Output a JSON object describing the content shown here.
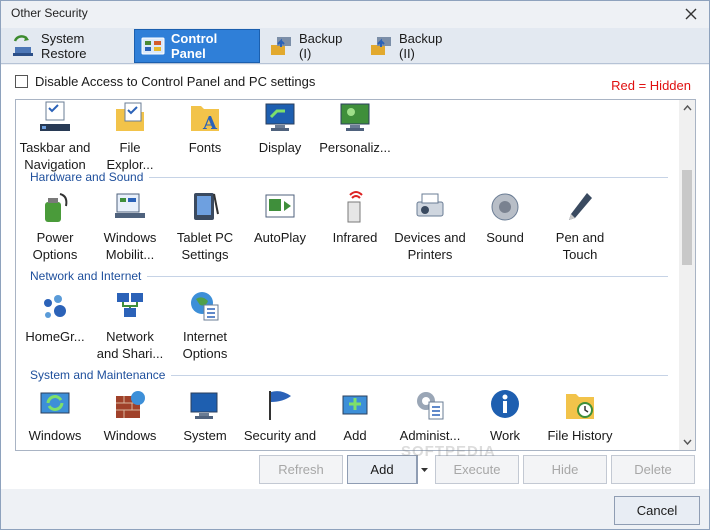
{
  "window": {
    "title": "Other Security",
    "close_icon": "close-icon"
  },
  "tabs": [
    {
      "label": "System Restore",
      "icon": "system-restore-icon",
      "active": false
    },
    {
      "label": "Control Panel",
      "icon": "control-panel-icon",
      "active": true
    },
    {
      "label": "Backup (I)",
      "icon": "backup-icon",
      "active": false
    },
    {
      "label": "Backup (II)",
      "icon": "backup-icon",
      "active": false
    }
  ],
  "options": {
    "disable_label": "Disable Access to Control Panel and PC settings",
    "checked": false,
    "legend": "Red = Hidden",
    "legend_color": "#e01010"
  },
  "top_items": [
    {
      "label": "Taskbar and\nNavigation",
      "icon": "taskbar-icon"
    },
    {
      "label": "File\nExplor...",
      "icon": "file-explorer-icon"
    },
    {
      "label": "Fonts",
      "icon": "fonts-icon"
    },
    {
      "label": "Display",
      "icon": "display-icon"
    },
    {
      "label": "Personaliz...",
      "icon": "personalization-icon"
    }
  ],
  "sections": [
    {
      "title": "Hardware and Sound",
      "items": [
        {
          "label": "Power\nOptions",
          "icon": "power-options-icon"
        },
        {
          "label": "Windows\nMobilit...",
          "icon": "mobility-icon"
        },
        {
          "label": "Tablet PC\nSettings",
          "icon": "tablet-icon"
        },
        {
          "label": "AutoPlay",
          "icon": "autoplay-icon"
        },
        {
          "label": "Infrared",
          "icon": "infrared-icon"
        },
        {
          "label": "Devices and\nPrinters",
          "icon": "printer-icon"
        },
        {
          "label": "Sound",
          "icon": "speaker-icon"
        },
        {
          "label": "Pen and\nTouch",
          "icon": "pen-icon"
        }
      ]
    },
    {
      "title": "Network and Internet",
      "items": [
        {
          "label": "HomeGr...",
          "icon": "homegroup-icon"
        },
        {
          "label": "Network\nand Shari...",
          "icon": "network-icon"
        },
        {
          "label": "Internet\nOptions",
          "icon": "globe-icon"
        }
      ]
    },
    {
      "title": "System and Maintenance",
      "items": [
        {
          "label": "Windows",
          "icon": "windows-update-icon"
        },
        {
          "label": "Windows",
          "icon": "firewall-icon"
        },
        {
          "label": "System",
          "icon": "system-icon"
        },
        {
          "label": "Security and",
          "icon": "flag-icon"
        },
        {
          "label": "Add",
          "icon": "add-icon"
        },
        {
          "label": "Administ...",
          "icon": "admin-tools-icon"
        },
        {
          "label": "Work",
          "icon": "info-icon"
        },
        {
          "label": "File History",
          "icon": "file-history-icon"
        }
      ]
    }
  ],
  "buttons": {
    "refresh": "Refresh",
    "add": "Add",
    "execute": "Execute",
    "hide": "Hide",
    "delete": "Delete",
    "cancel": "Cancel"
  },
  "watermark": "SOFTPEDIA"
}
